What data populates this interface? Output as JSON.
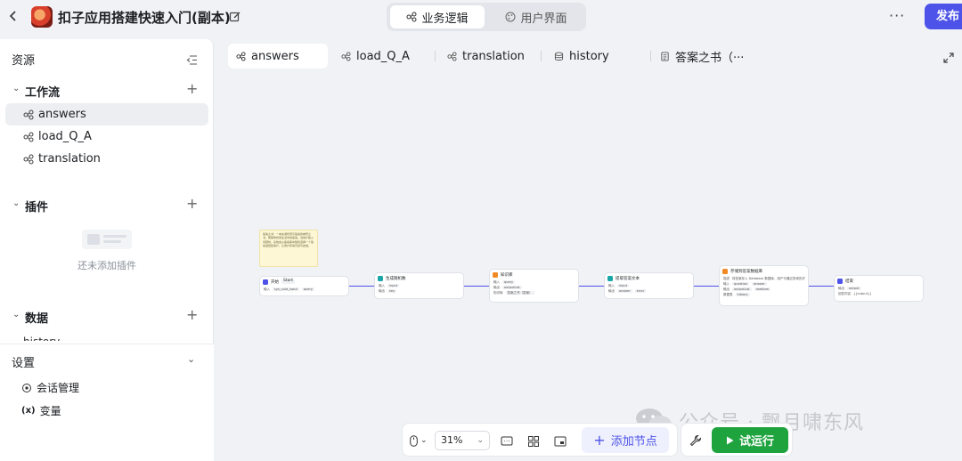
{
  "header": {
    "app_title": "扣子应用搭建快速入门(副本)",
    "modes": [
      {
        "label": "业务逻辑",
        "active": true,
        "icon": "workflow-icon"
      },
      {
        "label": "用户界面",
        "active": false,
        "icon": "palette-icon"
      }
    ],
    "more_label": "···",
    "publish_label": "发布"
  },
  "sidebar": {
    "resources_title": "资源",
    "sections": [
      {
        "title": "工作流",
        "items": [
          "answers",
          "load_Q_A",
          "translation"
        ],
        "selected": "answers"
      },
      {
        "title": "插件",
        "empty_text": "还未添加插件"
      },
      {
        "title": "数据",
        "partial_item": "history"
      }
    ],
    "settings": {
      "title": "设置",
      "items": [
        {
          "label": "会话管理",
          "icon": "chat-settings-icon"
        },
        {
          "label": "变量",
          "icon": "variable-icon",
          "glyph": "(x)"
        }
      ]
    }
  },
  "tabs": [
    {
      "label": "answers",
      "icon": "workflow-icon",
      "active": true
    },
    {
      "label": "load_Q_A",
      "icon": "workflow-icon",
      "active": false
    },
    {
      "label": "translation",
      "icon": "workflow-icon",
      "active": false
    },
    {
      "label": "history",
      "icon": "database-icon",
      "active": false
    },
    {
      "label": "答案之书（···",
      "icon": "page-icon",
      "active": false
    }
  ],
  "canvas": {
    "note_text": "答案之书：一本充满智慧与答案的神奇之书，帮助你找到生活中的答案。当用户输入问题时，系统会从答案库中随机选择一个答案返回给用户，让用户获得灵感与启发。",
    "nodes": [
      {
        "title": "开始",
        "tag": "Start",
        "color": "#4d53e8",
        "rows": [
          [
            "输入",
            "sys_uuid_input",
            "query"
          ]
        ]
      },
      {
        "title": "生成随机数",
        "color": "#1aa6a6",
        "rows": [
          [
            "输入",
            "input"
          ],
          [
            "输出",
            "key"
          ]
        ]
      },
      {
        "title": "知识库",
        "color": "#f08a24",
        "rows": [
          [
            "输入",
            "query"
          ],
          [
            "输出",
            "outputList"
          ],
          [
            "知识库",
            "答案之书（答案）"
          ]
        ]
      },
      {
        "title": "提取答案文本",
        "color": "#1aa6a6",
        "rows": [
          [
            "输入",
            "input"
          ],
          [
            "输出",
            "answer",
            "error"
          ]
        ]
      },
      {
        "title": "存储到答案数据库",
        "color": "#f08a24",
        "rows": [
          [
            "描述",
            "将答案存入 Database 数据库，用户可通过查询历史"
          ],
          [
            "输入",
            "question",
            "answer"
          ],
          [
            "输出",
            "outputList",
            "rowNum"
          ],
          [
            "数据表",
            "history"
          ]
        ]
      },
      {
        "title": "结束",
        "color": "#4d53e8",
        "rows": [
          [
            "输出",
            "output"
          ],
          [
            "回答内容",
            "{{output}}"
          ]
        ]
      }
    ]
  },
  "toolbar": {
    "zoom": "31%",
    "add_node_label": "添加节点",
    "run_label": "试运行"
  },
  "watermark": {
    "text": "公众号 · 飘月啸东风"
  },
  "colors": {
    "accent": "#4d53e8",
    "run_green": "#1fa33f"
  }
}
